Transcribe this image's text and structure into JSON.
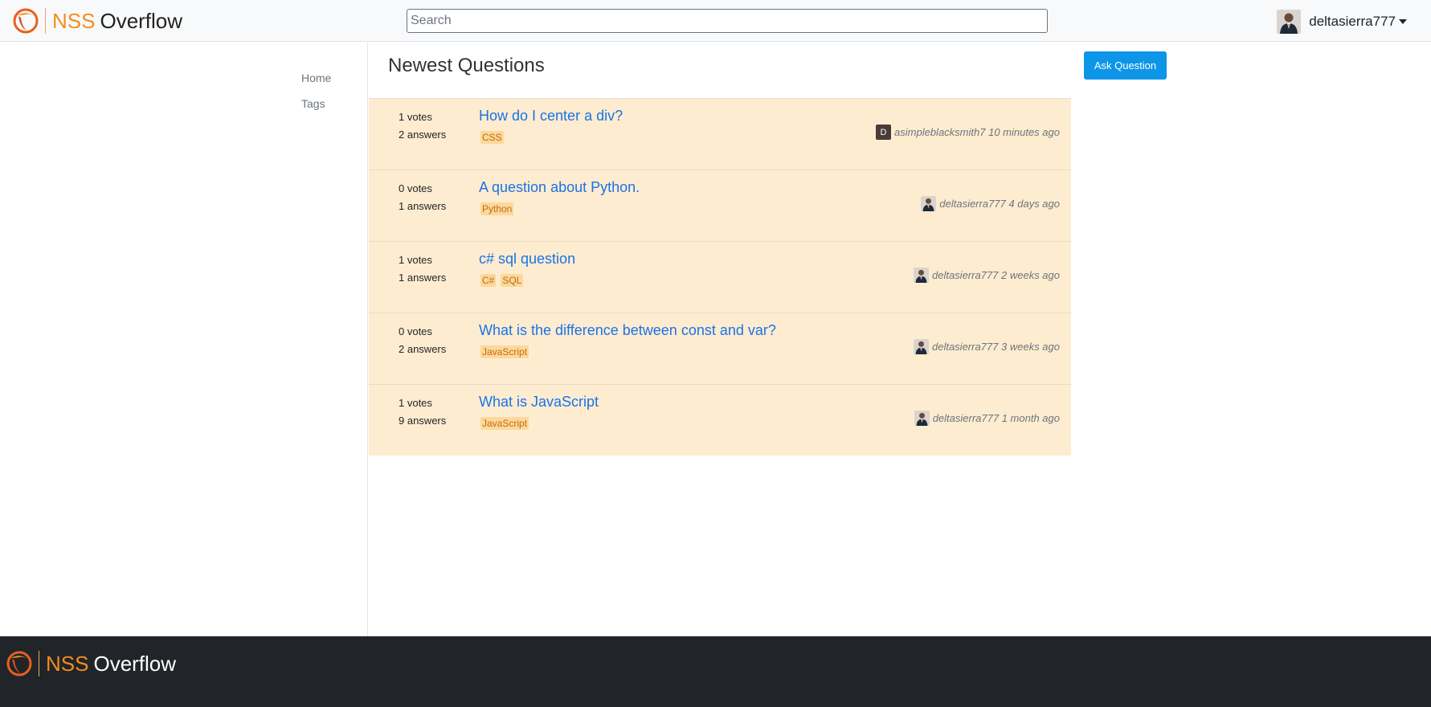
{
  "header": {
    "brand_primary": "NSS",
    "brand_secondary": "Overflow",
    "search_placeholder": "Search",
    "user_name": "deltasierra777"
  },
  "sidebar": {
    "items": [
      {
        "label": "Home"
      },
      {
        "label": "Tags"
      }
    ]
  },
  "main": {
    "title": "Newest Questions",
    "ask_button_label": "Ask Question",
    "questions": [
      {
        "votes": "1 votes",
        "answers": "2 answers",
        "title": "How do I center a div?",
        "tags": [
          "CSS"
        ],
        "author": "asimpleblacksmith7",
        "author_avatar": "letter",
        "author_initial": "D",
        "time": "10 minutes ago"
      },
      {
        "votes": "0 votes",
        "answers": "1 answers",
        "title": "A question about Python.",
        "tags": [
          "Python"
        ],
        "author": "deltasierra777",
        "author_avatar": "photo",
        "time": "4 days ago"
      },
      {
        "votes": "1 votes",
        "answers": "1 answers",
        "title": "c# sql question",
        "tags": [
          "C#",
          "SQL"
        ],
        "author": "deltasierra777",
        "author_avatar": "photo",
        "time": "2 weeks ago"
      },
      {
        "votes": "0 votes",
        "answers": "2 answers",
        "title": "What is the difference between const and var?",
        "tags": [
          "JavaScript"
        ],
        "author": "deltasierra777",
        "author_avatar": "photo",
        "time": "3 weeks ago"
      },
      {
        "votes": "1 votes",
        "answers": "9 answers",
        "title": "What is JavaScript",
        "tags": [
          "JavaScript"
        ],
        "author": "deltasierra777",
        "author_avatar": "photo",
        "time": "1 month ago"
      }
    ]
  },
  "footer": {
    "brand_primary": "NSS",
    "brand_secondary": "Overflow"
  },
  "colors": {
    "accent": "#f48c1f",
    "link": "#1a73e8",
    "question_bg": "#feecd0",
    "tag_bg": "#fbd99a",
    "button_bg": "#0d95e8",
    "footer_bg": "#212529"
  },
  "icons": {
    "logo": "nss-logo-icon",
    "dropdown": "caret-down-icon",
    "avatar": "user-avatar-icon"
  }
}
